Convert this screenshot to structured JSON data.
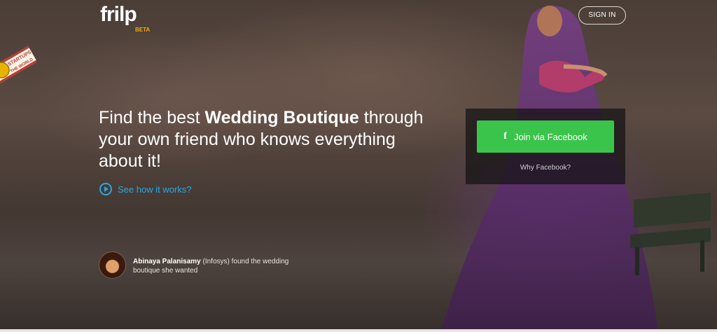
{
  "brand": {
    "name": "Frilp",
    "logo_text": "frilp",
    "badge": "BETA",
    "badge_color": "#f2a900"
  },
  "header": {
    "signin_label": "SIGN IN"
  },
  "ribbon": {
    "line1": "STARTUPS",
    "line2": "THE WORLD"
  },
  "hero": {
    "headline_pre": "Find the best ",
    "headline_bold": "Wedding Boutique",
    "headline_post": " through your own friend who knows everything about it!",
    "how_it_works": "See how it works?",
    "link_color": "#29a8e0"
  },
  "signup": {
    "facebook_icon": "facebook-f-icon",
    "facebook_label": "Join via Facebook",
    "why_label": "Why Facebook?",
    "button_color": "#3bc44b"
  },
  "testimonial": {
    "name": "Abinaya Palanisamy",
    "text": " (Infosys) found the wedding boutique she wanted"
  }
}
